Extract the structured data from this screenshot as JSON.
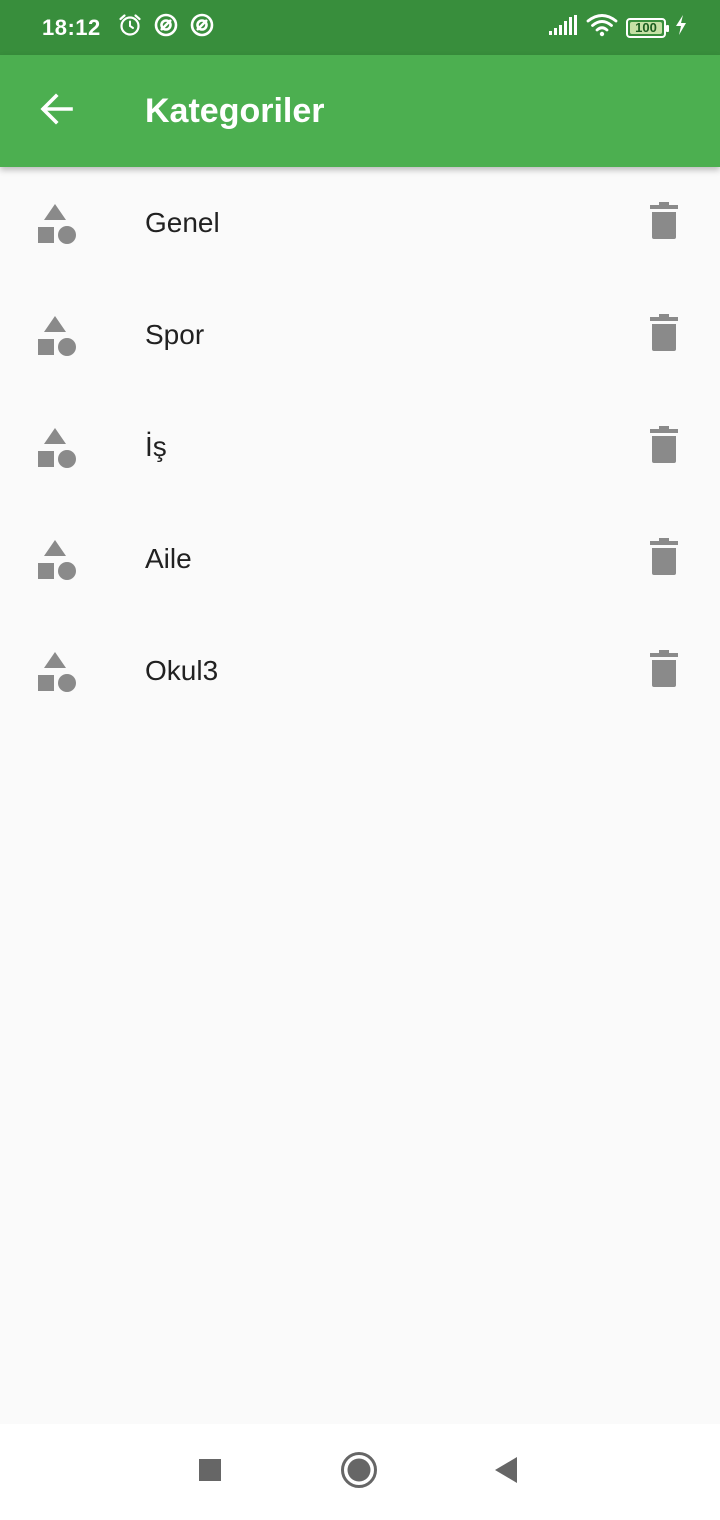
{
  "status_bar": {
    "time": "18:12",
    "battery": "100",
    "battery_level": 1.0,
    "icons_left": [
      "alarm-icon",
      "data-saver-icon",
      "data-saver-icon"
    ],
    "icons_right": [
      "signal-icon",
      "wifi-icon",
      "battery-icon",
      "charging-icon"
    ]
  },
  "app_bar": {
    "title": "Kategoriler",
    "back_icon": "arrow-back-icon"
  },
  "categories": [
    {
      "label": "Genel",
      "icon": "category-shapes-icon",
      "action_icon": "trash-icon"
    },
    {
      "label": "Spor",
      "icon": "category-shapes-icon",
      "action_icon": "trash-icon"
    },
    {
      "label": "İş",
      "icon": "category-shapes-icon",
      "action_icon": "trash-icon"
    },
    {
      "label": "Aile",
      "icon": "category-shapes-icon",
      "action_icon": "trash-icon"
    },
    {
      "label": "Okul3",
      "icon": "category-shapes-icon",
      "action_icon": "trash-icon"
    }
  ],
  "nav_bar": {
    "buttons": [
      "recents-square-icon",
      "home-circle-icon",
      "back-triangle-icon"
    ]
  },
  "colors": {
    "status_bar": "#388e3c",
    "app_bar": "#4caf50",
    "background": "#fafafa",
    "icon_gray": "#8a8a8a",
    "text": "#212121"
  }
}
